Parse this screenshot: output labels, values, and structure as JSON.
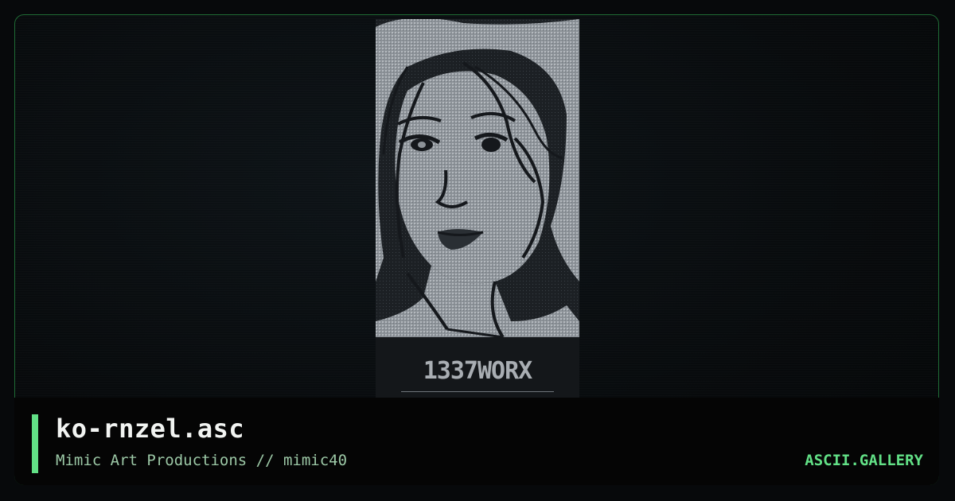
{
  "artwork": {
    "filename": "ko-rnzel.asc",
    "credit": "Mimic Art Productions // mimic40",
    "signature": "1337WORX",
    "subject": "ascii-portrait-of-girl-with-long-hair"
  },
  "site": {
    "brand": "ASCII.GALLERY"
  },
  "colors": {
    "accent": "#62e086",
    "title": "#f2f4f2",
    "credit": "#9cc8a6",
    "frame_border": "#1f6b35",
    "art_fill": "#9aa0a6",
    "art_ink": "#15181c"
  }
}
